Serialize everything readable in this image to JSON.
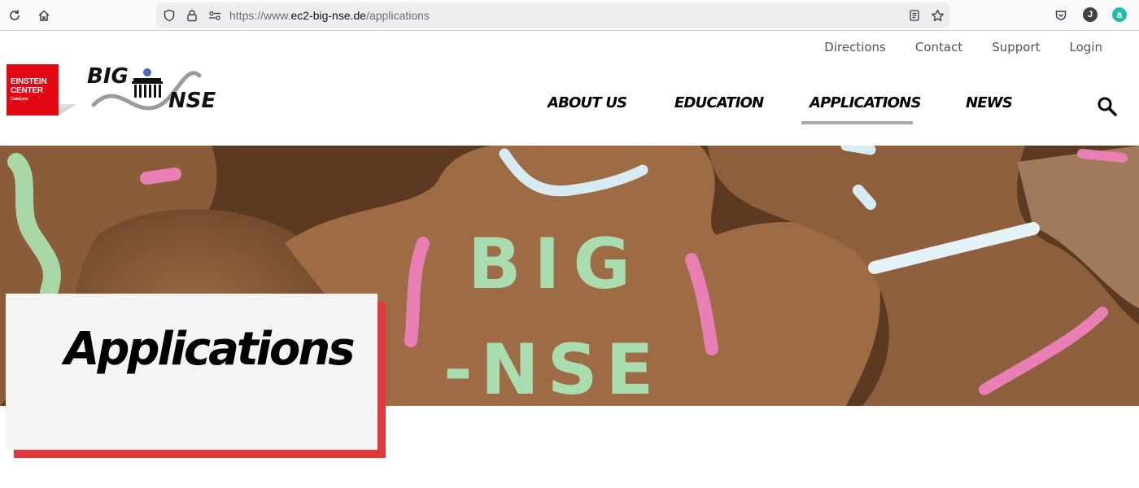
{
  "browser": {
    "url_prefix": "https://www.",
    "url_host": "ec2-big-nse.de",
    "url_path": "/applications",
    "profile_initial": "J",
    "extension_letter": "a"
  },
  "header": {
    "top_links": [
      "Directions",
      "Contact",
      "Support",
      "Login"
    ],
    "logo_einstein_line1": "EINSTEIN",
    "logo_einstein_line2": "CENTER",
    "logo_einstein_sub": "Catalysis",
    "logo_big": "BIG",
    "logo_nse": "NSE",
    "nav": [
      "ABOUT US",
      "EDUCATION",
      "APPLICATIONS",
      "NEWS"
    ],
    "active_nav": "APPLICATIONS"
  },
  "hero": {
    "title": "Applications",
    "cookie_text_1": "BIG",
    "cookie_text_2": "-NSE"
  },
  "colors": {
    "accent_red": "#e0383c",
    "einstein_red": "#e30613",
    "nav_underline": "#a9a9a9"
  }
}
